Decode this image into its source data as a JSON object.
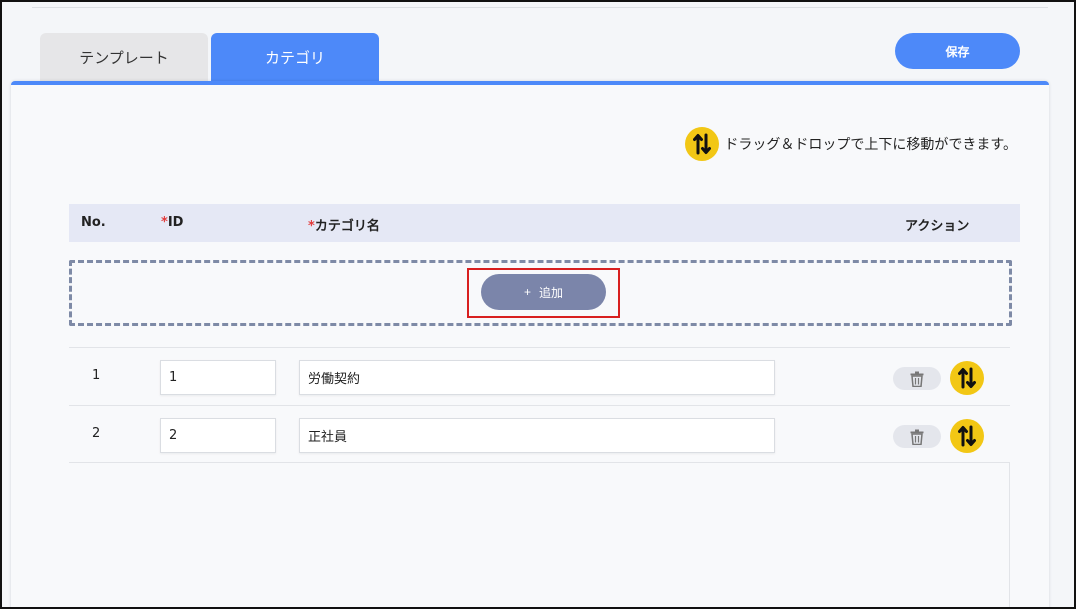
{
  "tabs": [
    {
      "label": "テンプレート",
      "active": false
    },
    {
      "label": "カテゴリ",
      "active": true
    }
  ],
  "toolbar": {
    "save_label": "保存"
  },
  "hint": {
    "text": "ドラッグ＆ドロップで上下に移動ができます。",
    "icon": "drag-sort-icon"
  },
  "table": {
    "headers": {
      "no": "No.",
      "id_required": "*",
      "id": "ID",
      "name_required": "*",
      "name": "カテゴリ名",
      "action": "アクション"
    },
    "add_button": {
      "plus": "+",
      "label": "追加"
    },
    "rows": [
      {
        "no": "1",
        "id": "1",
        "name": "労働契約"
      },
      {
        "no": "2",
        "id": "2",
        "name": "正社員"
      }
    ]
  },
  "colors": {
    "accent": "#4d89f9",
    "drag_icon": "#f2c715",
    "add_button": "#7b85aa",
    "highlight": "#d81f1f",
    "required": "#e23b3b"
  }
}
